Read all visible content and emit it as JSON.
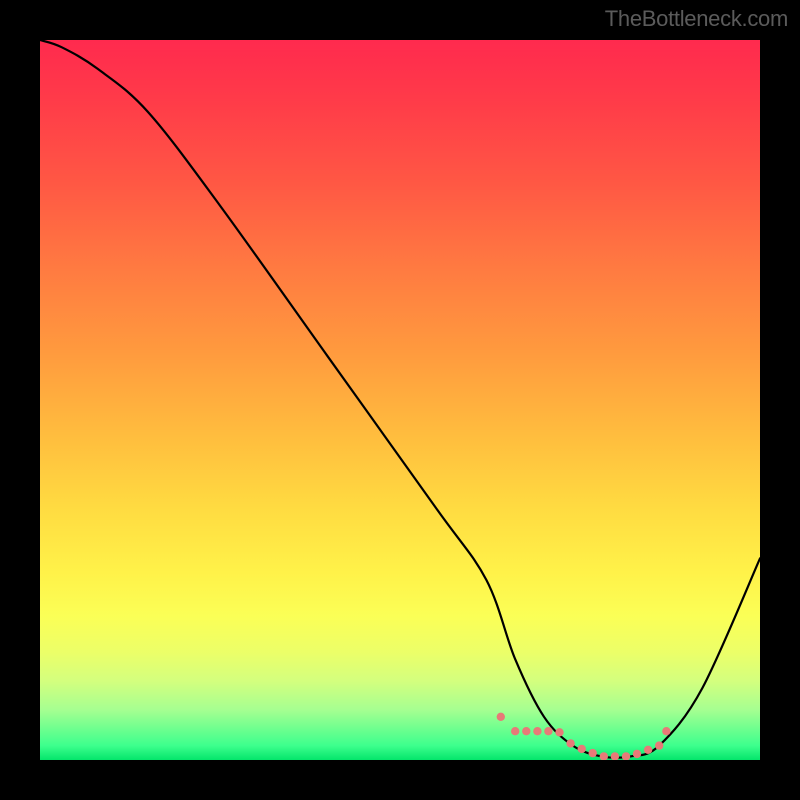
{
  "watermark": "TheBottleneck.com",
  "chart_data": {
    "type": "line",
    "title": "",
    "xlabel": "",
    "ylabel": "",
    "xlim": [
      0,
      100
    ],
    "ylim": [
      0,
      100
    ],
    "series": [
      {
        "name": "bottleneck-curve",
        "x": [
          0,
          3,
          8,
          15,
          25,
          40,
          55,
          62,
          66,
          70,
          74,
          78,
          82,
          86,
          92,
          100
        ],
        "values": [
          100,
          99,
          96,
          90,
          77,
          56,
          35,
          25,
          14,
          6,
          2,
          0.5,
          0.5,
          2,
          10,
          28
        ]
      }
    ],
    "flat_zone": {
      "x_start": 66,
      "x_end": 86,
      "y_max": 4
    },
    "gradient": {
      "top_color": "#ff2a4e",
      "mid_color": "#ffdb41",
      "bottom_color": "#04e56b"
    }
  }
}
